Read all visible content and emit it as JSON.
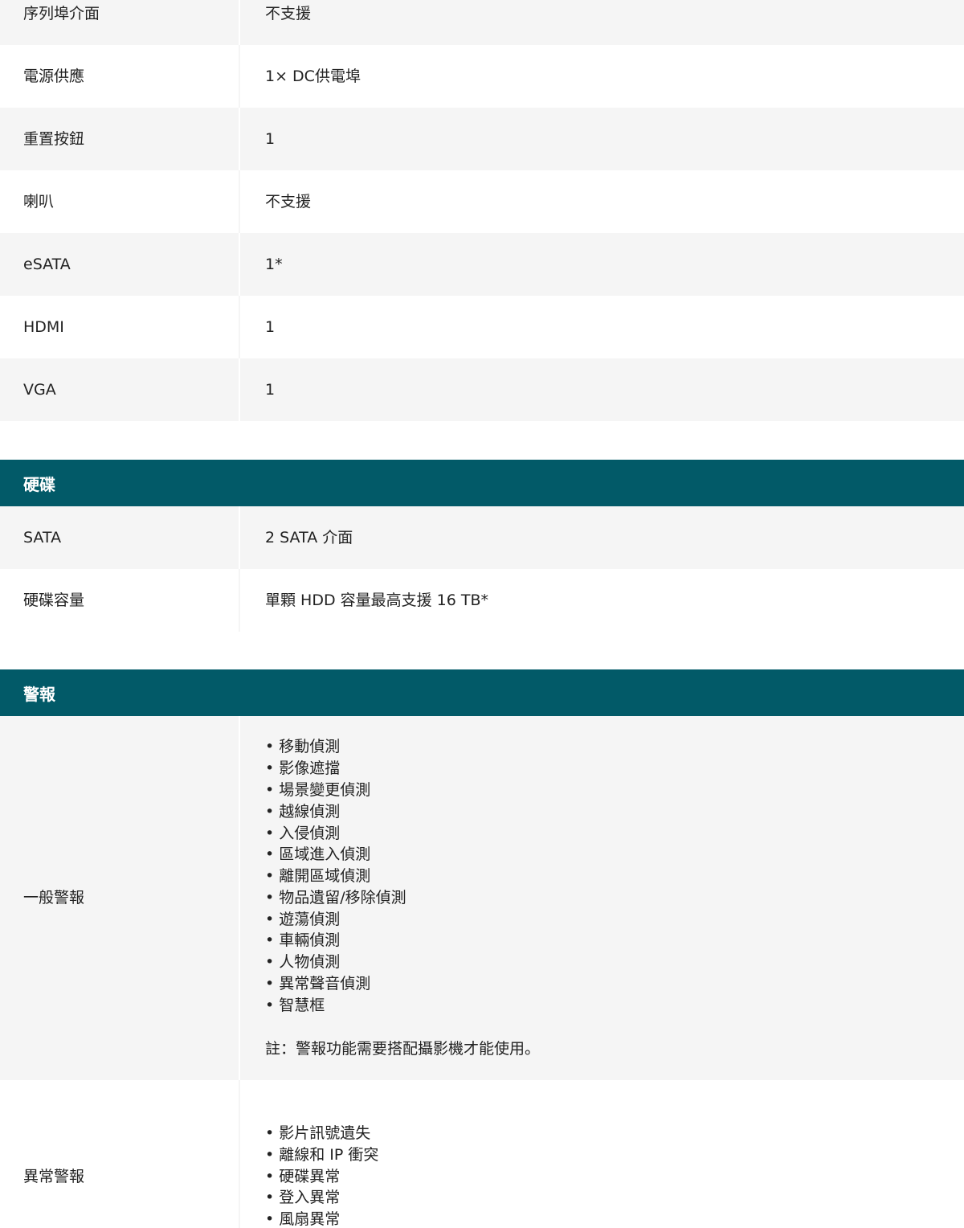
{
  "ports": {
    "rows": [
      {
        "label": "序列埠介面",
        "value": "不支援"
      },
      {
        "label": "電源供應",
        "value": "1× DC供電埠"
      },
      {
        "label": "重置按鈕",
        "value": "1"
      },
      {
        "label": "喇叭",
        "value": "不支援"
      },
      {
        "label": "eSATA",
        "value": "1*"
      },
      {
        "label": "HDMI",
        "value": "1"
      },
      {
        "label": "VGA",
        "value": "1"
      }
    ]
  },
  "hdd": {
    "title": "硬碟",
    "rows": [
      {
        "label": "SATA",
        "value": "2 SATA 介面"
      },
      {
        "label": "硬碟容量",
        "value": "單顆 HDD 容量最高支援 16 TB*"
      }
    ]
  },
  "alarm": {
    "title": "警報",
    "general": {
      "label": "一般警報",
      "items": [
        "移動偵測",
        "影像遮擋",
        "場景變更偵測",
        "越線偵測",
        "入侵偵測",
        "區域進入偵測",
        "離開區域偵測",
        "物品遺留/移除偵測",
        "遊蕩偵測",
        "車輛偵測",
        "人物偵測",
        "異常聲音偵測",
        "智慧框"
      ],
      "note": "註：警報功能需要搭配攝影機才能使用。"
    },
    "exception": {
      "label": "異常警報",
      "items": [
        "影片訊號遺失",
        "離線和 IP 衝突",
        "硬碟異常",
        "登入異常",
        "風扇異常"
      ]
    }
  }
}
